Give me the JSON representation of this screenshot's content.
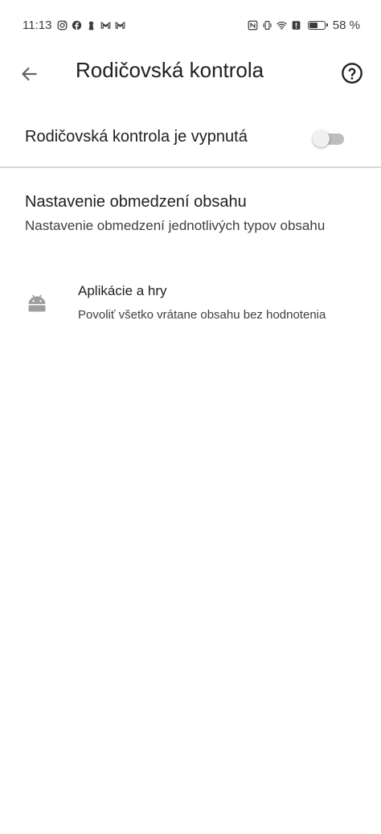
{
  "status_bar": {
    "time": "11:13",
    "left_icons": [
      "instagram-icon",
      "facebook-icon",
      "keyhole-icon",
      "gmail-icon",
      "gmail-icon"
    ],
    "right_icons": [
      "nfc-icon",
      "vibrate-icon",
      "wifi-icon",
      "alert-icon"
    ],
    "battery_level": 0.58,
    "battery_text": "58 %"
  },
  "app_bar": {
    "back_icon": "arrow-back-icon",
    "title": "Rodičovská kontrola",
    "help_icon": "help-circle-icon"
  },
  "parental_toggle": {
    "label": "Rodičovská kontrola je vypnutá",
    "enabled": false
  },
  "content_restrictions": {
    "title": "Nastavenie obmedzení obsahu",
    "subtitle": "Nastavenie obmedzení jednotlivých typov obsahu"
  },
  "apps_and_games": {
    "icon": "android-icon",
    "title": "Aplikácie a hry",
    "subtitle": "Povoliť všetko vrátane obsahu bez hodnotenia"
  },
  "colors": {
    "text_primary": "#202124",
    "text_secondary": "#3c4043",
    "icon_grey": "#9e9e9e",
    "divider": "#d9d9d9",
    "switch_track_off": "#bdbdbd"
  }
}
